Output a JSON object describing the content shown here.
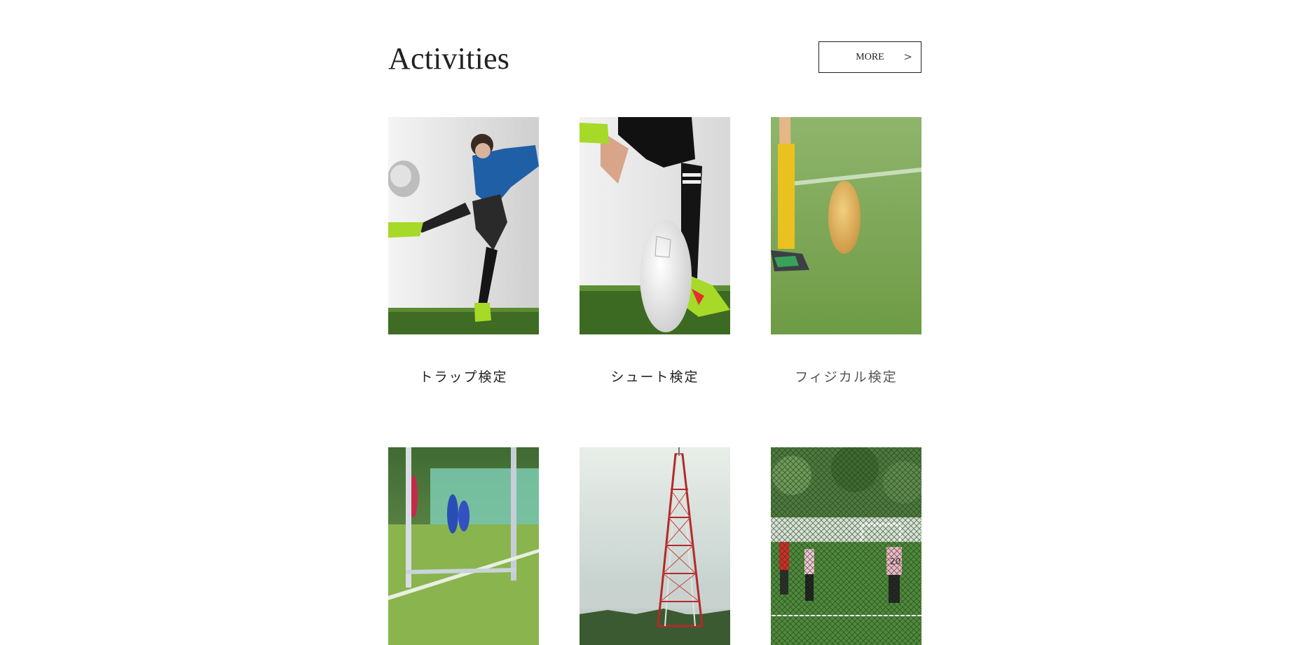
{
  "section": {
    "title": "Activities",
    "more_label": "MORE",
    "more_chevron": ">"
  },
  "activities": [
    {
      "caption": "トラップ検定",
      "image": "player-kicking-ball-photo"
    },
    {
      "caption": "シュート検定",
      "image": "shooting-leg-and-ball-photo"
    },
    {
      "caption": "フィジカル検定",
      "image": "ball-on-pitch-photo"
    },
    {
      "caption": "",
      "image": "goal-net-photo"
    },
    {
      "caption": "",
      "image": "steel-tower-photo"
    },
    {
      "caption": "",
      "image": "players-behind-fence-photo"
    }
  ],
  "colors": {
    "text": "#222222",
    "border": "#222222",
    "grass": "#5f9a3a",
    "sky": "#dfe6e3"
  }
}
